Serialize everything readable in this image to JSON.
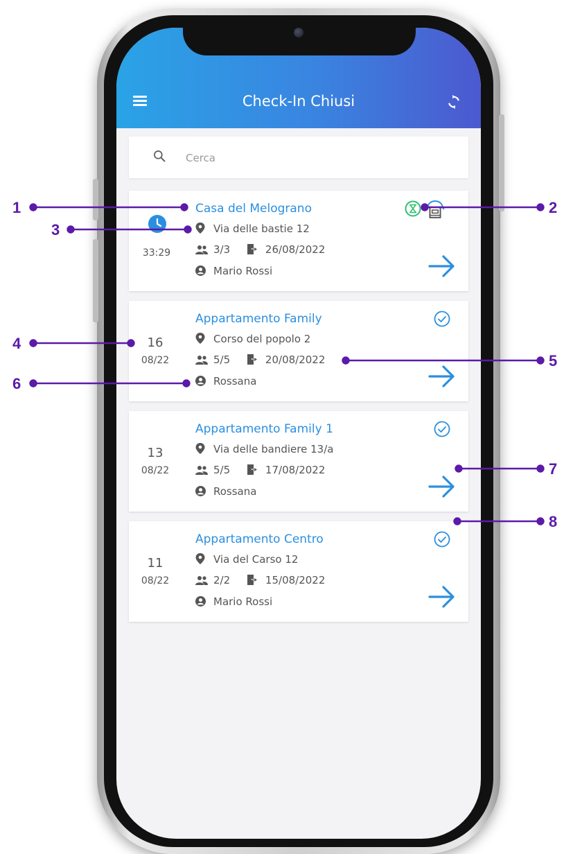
{
  "app": {
    "title": "Check-In Chiusi",
    "search_placeholder": "Cerca",
    "accent_color": "#2b8fe0",
    "header_gradient": [
      "#2aa3e6",
      "#4c59cf"
    ],
    "annotation_color": "#5b1aa8"
  },
  "cards": [
    {
      "name": "Casa del Melograno",
      "address": "Via delle bastie 12",
      "guests": "3/3",
      "checkin_date": "26/08/2022",
      "owner": "Mario Rossi",
      "timer": "33:29",
      "status_icon": "hourglass-icon",
      "extra_icon": "building-icon"
    },
    {
      "name": "Appartamento Family",
      "address": "Corso del popolo 2",
      "guests": "5/5",
      "checkin_date": "20/08/2022",
      "owner": "Rossana",
      "day": "16",
      "month": "08/22",
      "status_icon": "check-circle-icon"
    },
    {
      "name": "Appartamento Family 1",
      "address": "Via delle bandiere 13/a",
      "guests": "5/5",
      "checkin_date": "17/08/2022",
      "owner": "Rossana",
      "day": "13",
      "month": "08/22",
      "status_icon": "check-circle-icon"
    },
    {
      "name": "Appartamento Centro",
      "address": "Via del Carso 12",
      "guests": "2/2",
      "checkin_date": "15/08/2022",
      "owner": "Mario Rossi",
      "day": "11",
      "month": "08/22",
      "status_icon": "check-circle-icon"
    }
  ],
  "annotations": [
    "1",
    "2",
    "3",
    "4",
    "5",
    "6",
    "7",
    "8"
  ]
}
